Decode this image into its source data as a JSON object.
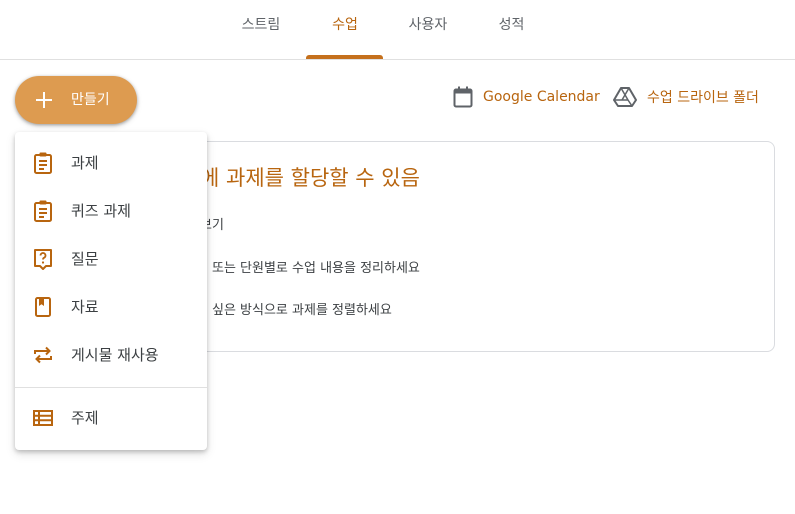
{
  "tabs": [
    {
      "label": "스트림"
    },
    {
      "label": "수업"
    },
    {
      "label": "사용자"
    },
    {
      "label": "성적"
    }
  ],
  "active_tab": "수업",
  "create_button": {
    "label": "만들기"
  },
  "links": {
    "calendar": "Google Calendar",
    "drive": "수업 드라이브 폴더"
  },
  "card": {
    "title": "에 과제를 할당할 수 있음",
    "lines": [
      "보기",
      "또는 단원별로 수업 내용을 정리하세요",
      "싶은 방식으로 과제를 정렬하세요"
    ]
  },
  "menu": {
    "items": [
      {
        "label": "과제",
        "icon": "assignment-icon"
      },
      {
        "label": "퀴즈 과제",
        "icon": "quiz-assignment-icon"
      },
      {
        "label": "질문",
        "icon": "question-icon"
      },
      {
        "label": "자료",
        "icon": "material-icon"
      },
      {
        "label": "게시물 재사용",
        "icon": "reuse-post-icon"
      },
      {
        "label": "주제",
        "icon": "topic-icon"
      }
    ]
  },
  "colors": {
    "accent": "#b8650f",
    "button": "#dd9b50"
  }
}
